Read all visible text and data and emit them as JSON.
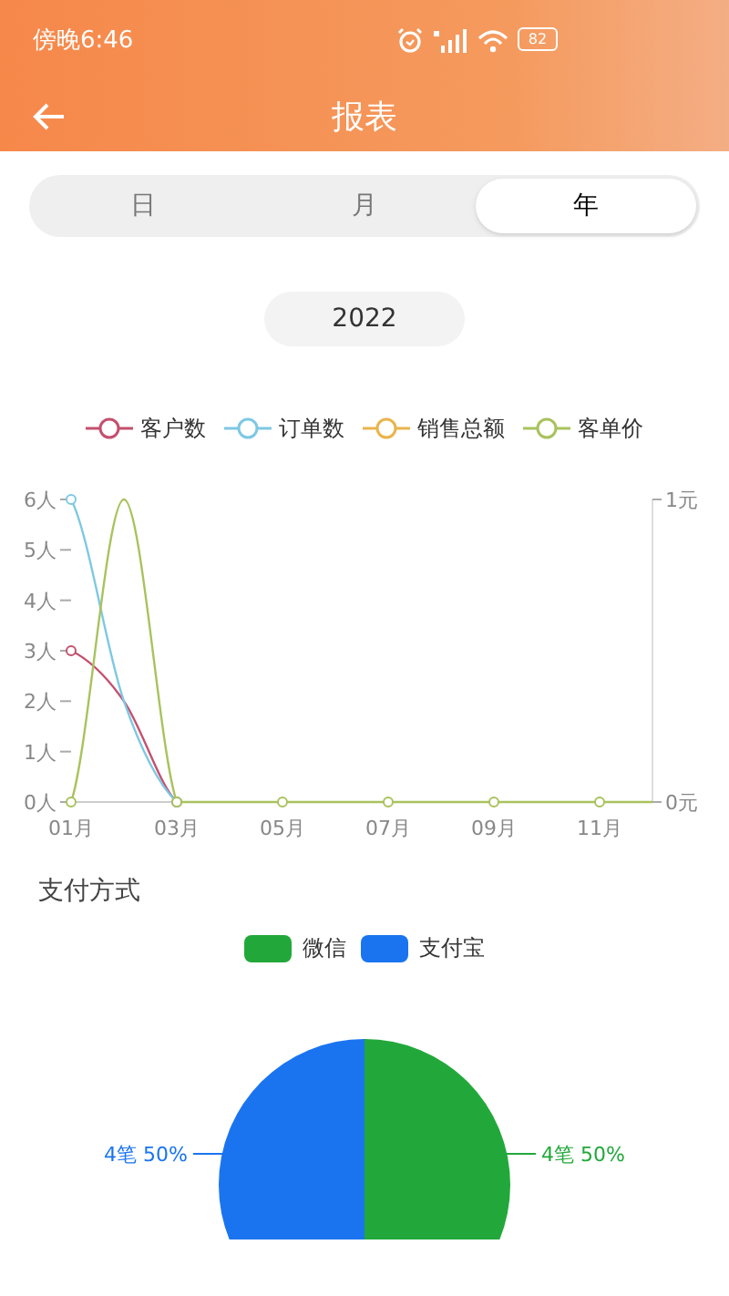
{
  "status_bar": {
    "time": "傍晚6:46",
    "battery": "82"
  },
  "header": {
    "title": "报表"
  },
  "tabs": [
    {
      "label": "日",
      "selected": false
    },
    {
      "label": "月",
      "selected": false
    },
    {
      "label": "年",
      "selected": true
    }
  ],
  "year_picker": {
    "value": "2022"
  },
  "trend_chart": {
    "chart_data": {
      "type": "line",
      "x": [
        1,
        2,
        3,
        4,
        5,
        6,
        7,
        8,
        9,
        10,
        11,
        12
      ],
      "xlim": [
        1,
        12
      ],
      "ylim": [
        0,
        6
      ],
      "y2lim": [
        0,
        1
      ],
      "xticks": [
        {
          "value": 1,
          "label": "01月"
        },
        {
          "value": 3,
          "label": "03月"
        },
        {
          "value": 5,
          "label": "05月"
        },
        {
          "value": 7,
          "label": "07月"
        },
        {
          "value": 9,
          "label": "09月"
        },
        {
          "value": 11,
          "label": "11月"
        }
      ],
      "yticks": [
        {
          "value": 0,
          "label": "0人"
        },
        {
          "value": 1,
          "label": "1人"
        },
        {
          "value": 2,
          "label": "2人"
        },
        {
          "value": 3,
          "label": "3人"
        },
        {
          "value": 4,
          "label": "4人"
        },
        {
          "value": 5,
          "label": "5人"
        },
        {
          "value": 6,
          "label": "6人"
        }
      ],
      "y2ticks": [
        {
          "value": 0,
          "label": "0元"
        },
        {
          "value": 1,
          "label": "1元"
        }
      ],
      "series": [
        {
          "name": "客户数",
          "color": "#c4506e",
          "axis": "y",
          "values": [
            3,
            2,
            0,
            null,
            null,
            null,
            null,
            null,
            null,
            null,
            null,
            null
          ]
        },
        {
          "name": "订单数",
          "color": "#7ec8e3",
          "axis": "y",
          "values": [
            6,
            2,
            0,
            null,
            null,
            null,
            null,
            null,
            null,
            null,
            null,
            null
          ]
        },
        {
          "name": "销售总额",
          "color": "#e9b44c",
          "values": [
            null,
            null,
            null,
            null,
            null,
            null,
            null,
            null,
            null,
            null,
            null,
            null
          ]
        },
        {
          "name": "客单价",
          "color": "#a9c25d",
          "axis": "y2",
          "values": [
            0,
            1,
            0,
            0,
            0,
            0,
            0,
            0,
            0,
            0,
            0,
            0
          ]
        }
      ]
    }
  },
  "payment": {
    "title": "支付方式",
    "chart_data": {
      "type": "pie",
      "categories": [
        "微信",
        "支付宝"
      ],
      "series": [
        {
          "colors": [
            "#22a83a",
            "#1a74f0"
          ],
          "values": [
            50,
            50
          ]
        }
      ],
      "value_labels": [
        "4笔 50%",
        "4笔 50%"
      ]
    }
  }
}
